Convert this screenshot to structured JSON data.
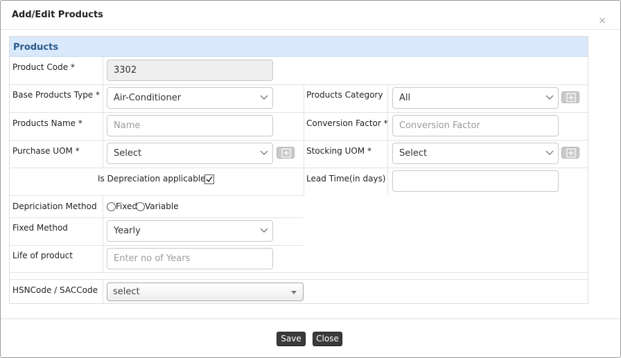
{
  "dialog": {
    "title": "Add/Edit Products",
    "close_glyph": "×"
  },
  "panel": {
    "heading": "Products"
  },
  "form": {
    "product_code": {
      "label": "Product Code *",
      "value": "3302"
    },
    "base_products_type": {
      "label": "Base Products Type *",
      "value": "Air-Conditioner"
    },
    "products_category": {
      "label": "Products Category",
      "value": "All"
    },
    "products_name": {
      "label": "Products Name *",
      "placeholder": "Name"
    },
    "conversion_factor": {
      "label": "Conversion Factor *",
      "placeholder": "Conversion Factor"
    },
    "purchase_uom": {
      "label": "Purchase UOM *",
      "value": "Select"
    },
    "stocking_uom": {
      "label": "Stocking UOM *",
      "value": "Select"
    },
    "is_depreciation": {
      "label": "Is Depreciation applicable",
      "checked": true
    },
    "lead_time": {
      "label": "Lead Time(in days)",
      "value": ""
    },
    "depreciation_method": {
      "label": "Depriciation Method",
      "options": [
        "Fixed",
        "Variable"
      ]
    },
    "fixed_method": {
      "label": "Fixed Method",
      "value": "Yearly"
    },
    "life_of_product": {
      "label": "Life of product",
      "placeholder": "Enter no of Years"
    },
    "hsn_code": {
      "label": "HSNCode / SACCode",
      "value": "select"
    }
  },
  "footer": {
    "save_label": "Save",
    "close_label": "Close"
  },
  "colors": {
    "panel_heading_bg": "#d9e8fb",
    "panel_heading_text": "#2a5b8c",
    "button_bg": "#3b3b3b"
  }
}
